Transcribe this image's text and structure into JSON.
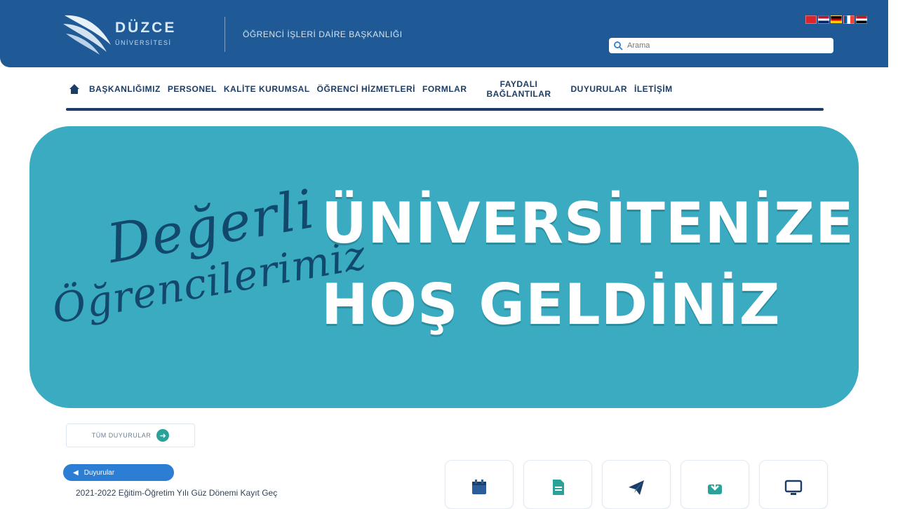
{
  "header": {
    "logo_title": "DÜZCE",
    "logo_subtitle": "ÜNİVERSİTESİ",
    "department": "ÖĞRENCİ İŞLERİ DAİRE BAŞKANLIĞI",
    "languages": [
      "tr-flag-icon",
      "en-flag-icon",
      "de-flag-icon",
      "fr-flag-icon",
      "ar-flag-icon"
    ],
    "search": {
      "placeholder": "Arama",
      "value": ""
    }
  },
  "nav": {
    "items": [
      {
        "label": "BAŞKANLIĞIMIZ"
      },
      {
        "label": "PERSONEL"
      },
      {
        "label": "KALİTE KURUMSAL"
      },
      {
        "label": "ÖĞRENCİ HİZMETLERİ"
      },
      {
        "label": "FORMLAR"
      },
      {
        "label": "FAYDALI BAĞLANTILAR"
      },
      {
        "label": "DUYURULAR"
      },
      {
        "label": "İLETİŞİM"
      }
    ]
  },
  "banner": {
    "script_line1": "Değerli",
    "script_line2": "Öğrencilerimiz",
    "headline_line1": "ÜNİVERSİTENİZE",
    "headline_line2": "HOŞ GELDİNİZ"
  },
  "announcements": {
    "all_label": "TÜM DUYURULAR",
    "badge_label": "Duyurular",
    "first_title": "2021-2022 Eğitim-Öğretim Yılı Güz Dönemi Kayıt Geç"
  },
  "quick_links": [
    {
      "icon": "calendar-icon"
    },
    {
      "icon": "document-icon"
    },
    {
      "icon": "paper-plane-icon"
    },
    {
      "icon": "inbox-download-icon"
    },
    {
      "icon": "monitor-icon"
    }
  ],
  "colors": {
    "header_bg": "#1f5a96",
    "nav_text": "#1b3d66",
    "banner_bg": "#3aabc1",
    "script_text": "#12486b",
    "badge_bg": "#2b7ed4",
    "accent_green": "#2aa29a"
  }
}
